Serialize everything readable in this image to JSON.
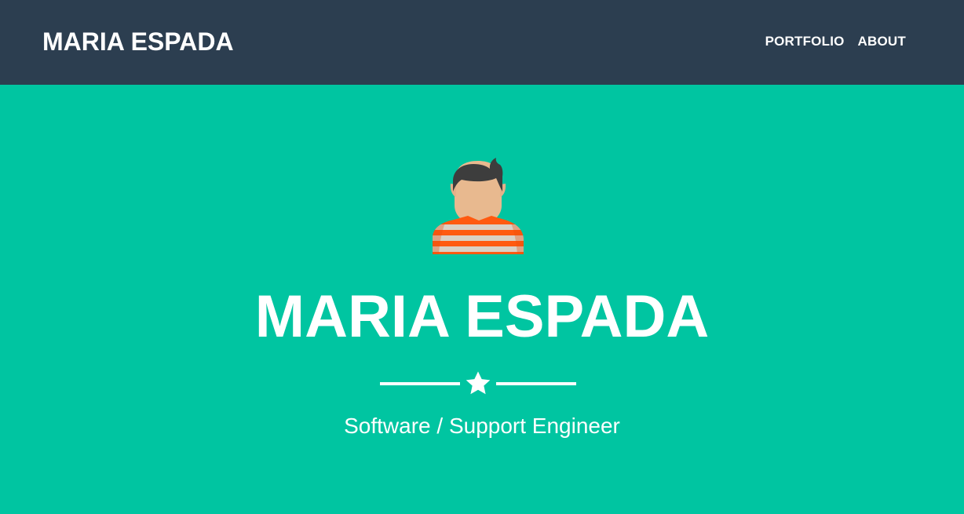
{
  "navbar": {
    "brand": "MARIA ESPADA",
    "links": [
      {
        "label": "PORTFOLIO"
      },
      {
        "label": "ABOUT"
      }
    ]
  },
  "hero": {
    "avatar_icon": "person-avatar-icon",
    "title": "MARIA ESPADA",
    "divider_icon": "star-icon",
    "subtitle": "Software / Support Engineer"
  },
  "colors": {
    "navbar_bg": "#2c3e50",
    "hero_bg": "#00c5a1",
    "text": "#ffffff",
    "shirt_orange": "#ff5a10",
    "shirt_stripe": "#d9d0c4",
    "skin": "#e8b98f",
    "hair": "#3d3d3d"
  }
}
